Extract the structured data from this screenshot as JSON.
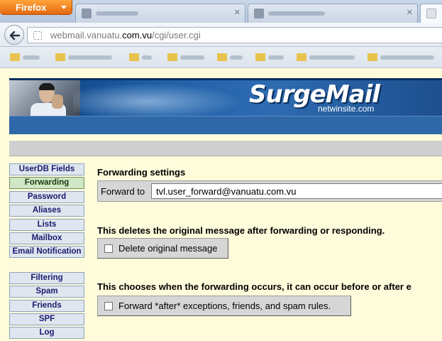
{
  "browser": {
    "menu_button": "Firefox",
    "url_prefix": "webmail.vanuatu.",
    "url_domain": "com.vu",
    "url_path": "/cgi/user.cgi"
  },
  "banner": {
    "logo": "SurgeMail",
    "logo_sub": "netwinsite.com"
  },
  "sidebar": {
    "items": [
      {
        "label": "UserDB Fields"
      },
      {
        "label": "Forwarding",
        "active": true
      },
      {
        "label": "Password"
      },
      {
        "label": "Aliases"
      },
      {
        "label": "Lists"
      },
      {
        "label": "Mailbox"
      },
      {
        "label": "Email Notification"
      }
    ],
    "items2": [
      {
        "label": "Filtering"
      },
      {
        "label": "Spam"
      },
      {
        "label": "Friends"
      },
      {
        "label": "SPF"
      },
      {
        "label": "Log"
      }
    ]
  },
  "main": {
    "title": "Forwarding settings",
    "forward_label": "Forward to",
    "forward_value": "tvl.user_forward@vanuatu.com.vu",
    "delete_note": "This deletes the original message after forwarding or responding.",
    "delete_label": "Delete original message",
    "delete_checked": false,
    "when_note": "This chooses when the forwarding occurs, it can occur before or after e",
    "after_label": "Forward *after* exceptions, friends, and spam rules.",
    "after_checked": false
  },
  "colors": {
    "page_bg": "#fffcdc",
    "banner": "#1f5fa6",
    "active_nav": "#cfe7c5"
  }
}
